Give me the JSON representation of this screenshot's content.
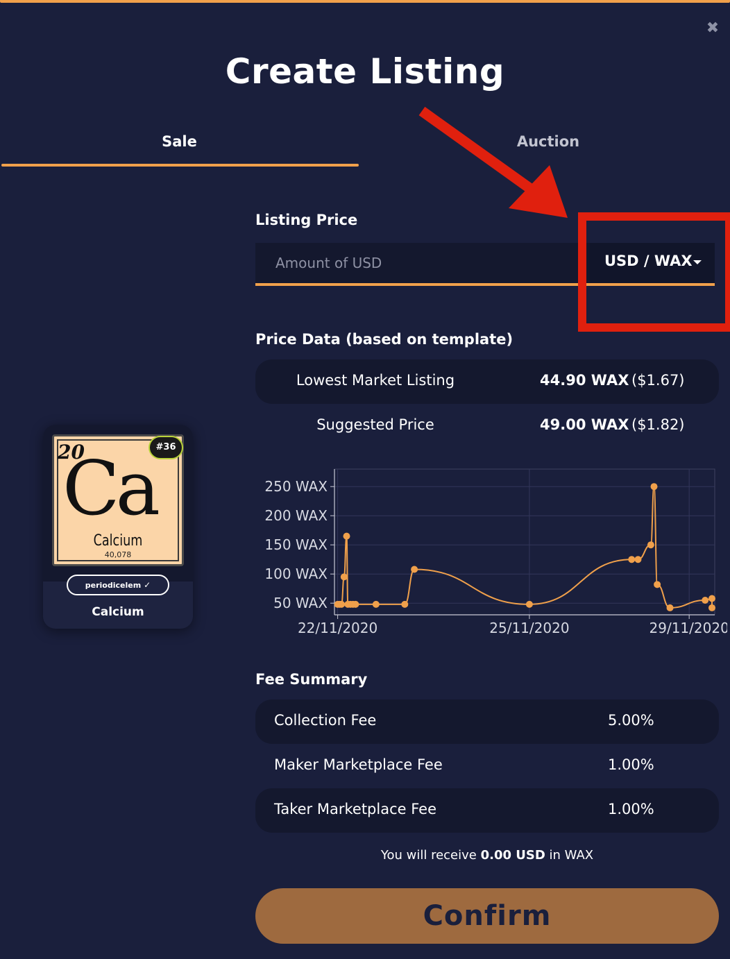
{
  "dialog": {
    "title": "Create Listing",
    "close_icon": "close-icon"
  },
  "tabs": [
    {
      "label": "Sale",
      "active": true
    },
    {
      "label": "Auction",
      "active": false
    }
  ],
  "listing_price": {
    "label": "Listing Price",
    "input_value": "",
    "input_placeholder": "Amount of USD",
    "currency_toggle": "USD / WAX"
  },
  "price_data": {
    "label": "Price Data (based on template)",
    "rows": [
      {
        "label": "Lowest Market Listing",
        "wax": "44.90 WAX",
        "usd": "($1.67)"
      },
      {
        "label": "Suggested Price",
        "wax": "49.00 WAX",
        "usd": "($1.82)"
      }
    ]
  },
  "chart_data": {
    "type": "line",
    "title": "",
    "xlabel": "",
    "ylabel": "",
    "y_tick_labels": [
      "250 WAX",
      "200 WAX",
      "150 WAX",
      "100 WAX",
      "50 WAX"
    ],
    "y_ticks": [
      250,
      200,
      150,
      100,
      50
    ],
    "x_tick_labels": [
      "22/11/2020",
      "25/11/2020",
      "29/11/2020"
    ],
    "x_ticks": [
      0,
      3,
      5.5
    ],
    "xlim": [
      -0.05,
      5.9
    ],
    "ylim": [
      30,
      280
    ],
    "grid": true,
    "color": "#f0a04b",
    "series": [
      {
        "x": [
          0.0,
          0.03,
          0.06,
          0.1,
          0.14,
          0.16,
          0.2,
          0.24,
          0.28,
          0.6,
          1.05,
          1.2,
          3.0,
          4.6,
          4.7,
          4.9,
          4.95,
          5.0,
          5.2,
          5.75,
          5.9,
          6.1
        ],
        "y": [
          48,
          48,
          48,
          95,
          165,
          48,
          48,
          48,
          48,
          48,
          48,
          108,
          48,
          125,
          125,
          150,
          250,
          82,
          42,
          55,
          58,
          42
        ]
      }
    ]
  },
  "fee_summary": {
    "label": "Fee Summary",
    "rows": [
      {
        "label": "Collection Fee",
        "value": "5.00%"
      },
      {
        "label": "Maker Marketplace Fee",
        "value": "1.00%"
      },
      {
        "label": "Taker Marketplace Fee",
        "value": "1.00%"
      }
    ]
  },
  "receive": {
    "prefix": "You will receive",
    "amount": "0.00 USD",
    "suffix": "in WAX"
  },
  "confirm_label": "Confirm",
  "asset_card": {
    "mint": "#36",
    "element_number": "20",
    "element_symbol": "Ca",
    "element_name": "Calcium",
    "element_mass": "40,078",
    "collection": "periodicelem",
    "name": "Calcium"
  },
  "colors": {
    "background": "#1a1f3c",
    "accent": "#f0a04b",
    "confirm_button": "#9e6a3f",
    "annotation_red": "#e0200e"
  }
}
